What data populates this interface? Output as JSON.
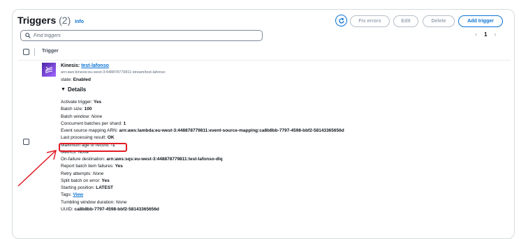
{
  "header": {
    "title": "Triggers",
    "count": "(2)",
    "info": "Info"
  },
  "toolbar": {
    "fix_errors": "Fix errors",
    "edit": "Edit",
    "delete": "Delete",
    "add_trigger": "Add trigger"
  },
  "search": {
    "placeholder": "Find triggers"
  },
  "pagination": {
    "prev": "‹",
    "page": "1",
    "next": "›"
  },
  "table": {
    "column_header": "Trigger"
  },
  "trigger": {
    "service": "Kinesis:",
    "name": "test-lafonso",
    "arn": "arn:aws:kinesis:eu-west-3:448878779811:stream/test-lafonso",
    "state_label": "state:",
    "state_value": "Enabled",
    "details_label": "Details",
    "details": [
      {
        "label": "Activate trigger:",
        "value": "Yes",
        "style": "bold"
      },
      {
        "label": "Batch size:",
        "value": "100",
        "style": "bold"
      },
      {
        "label": "Batch window:",
        "value": "None",
        "style": "italic"
      },
      {
        "label": "Concurrent batches per shard:",
        "value": "1",
        "style": "bold"
      },
      {
        "label": "Event source mapping ARN:",
        "value": "arn:aws:lambda:eu-west-3:448878779811:event-source-mapping:ca8b8bb-7797-4598-bbf2-58143365656d",
        "style": "bold"
      },
      {
        "label": "Last processing result:",
        "value": "OK",
        "style": "bold"
      },
      {
        "label": "Maximum age of record:",
        "value": "-1",
        "style": "bold"
      },
      {
        "label": "Metrics:",
        "value": "None",
        "style": "italic"
      },
      {
        "label": "On-failure destination:",
        "value": "arn:aws:sqs:eu-west-3:448878779811:test-lafonso-dlq",
        "style": "bold"
      },
      {
        "label": "Report batch item failures:",
        "value": "Yes",
        "style": "bold"
      },
      {
        "label": "Retry attempts:",
        "value": "None",
        "style": "italic"
      },
      {
        "label": "Split batch on error:",
        "value": "Yes",
        "style": "bold"
      },
      {
        "label": "Starting position:",
        "value": "LATEST",
        "style": "bold"
      },
      {
        "label": "Tags:",
        "value": "View",
        "style": "link"
      },
      {
        "label": "Tumbling window duration:",
        "value": "None",
        "style": "italic"
      },
      {
        "label": "UUID:",
        "value": "ca8b8bb-7797-4598-bbf2-58143365656d",
        "style": "bold"
      }
    ]
  },
  "annotation": {
    "color": "#e01b24"
  },
  "colors": {
    "accent": "#0972d3",
    "kinesis_purple": "#8c4fff"
  }
}
